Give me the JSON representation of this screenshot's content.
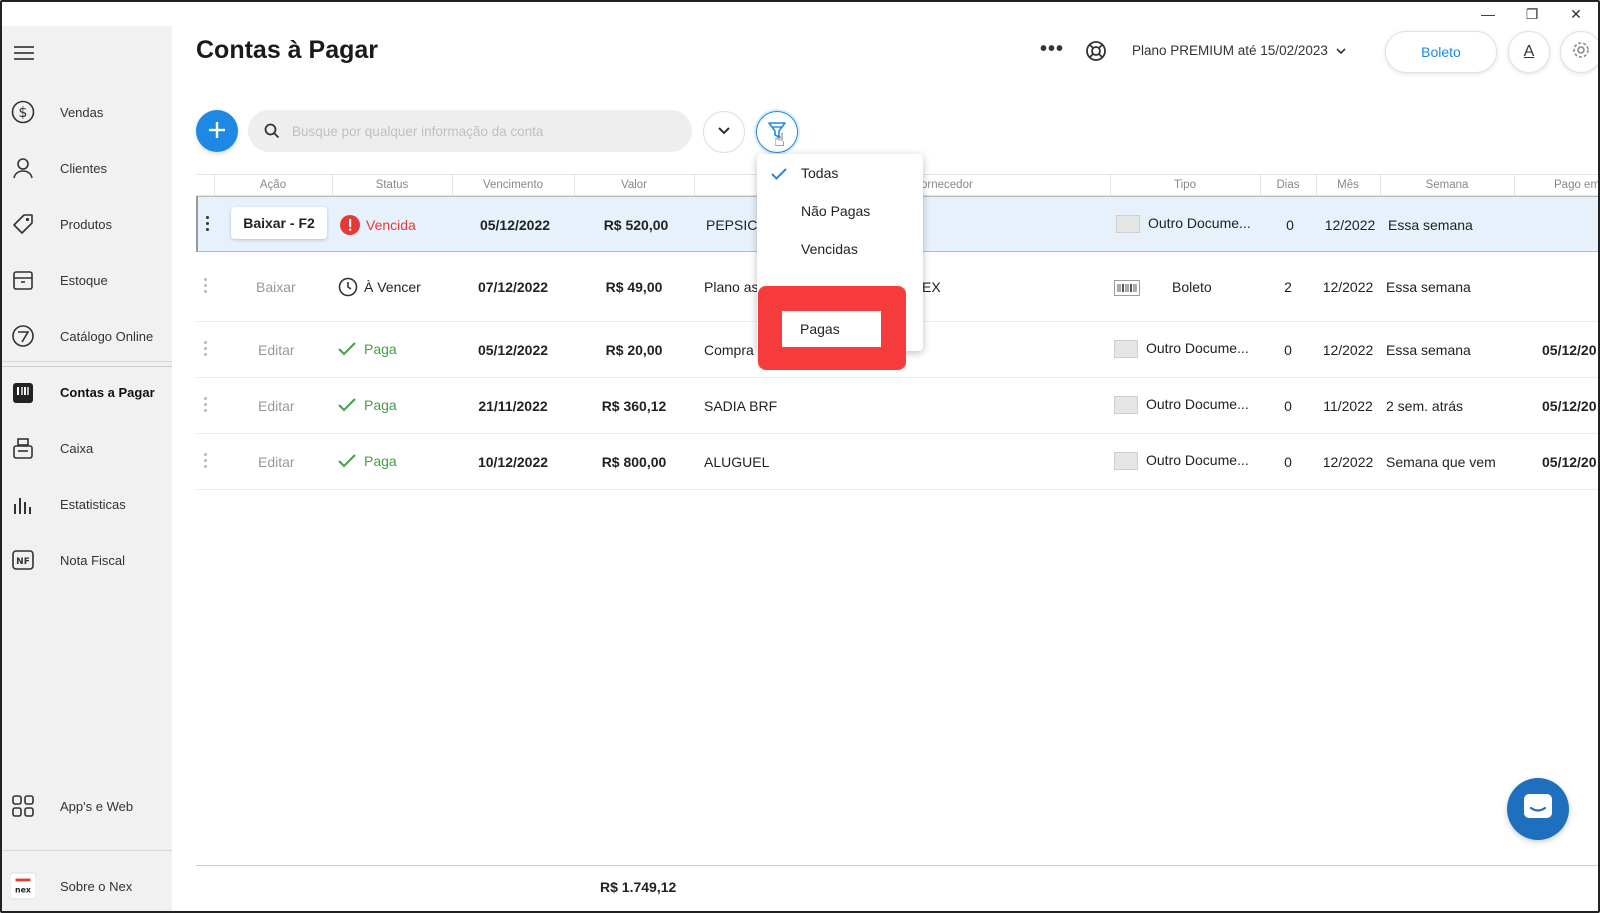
{
  "window": {
    "minimize": "—",
    "restore": "❐",
    "close": "✕"
  },
  "page": {
    "title": "Contas à Pagar"
  },
  "header": {
    "more": "•••",
    "plan": "Plano PREMIUM até 15/02/2023",
    "boleto_button": "Boleto",
    "font_button": "A"
  },
  "sidebar": {
    "items": [
      {
        "label": "Vendas",
        "icon": "dollar-icon"
      },
      {
        "label": "Clientes",
        "icon": "user-icon"
      },
      {
        "label": "Produtos",
        "icon": "tag-icon"
      },
      {
        "label": "Estoque",
        "icon": "box-icon"
      },
      {
        "label": "Catálogo Online",
        "icon": "catalog-icon"
      },
      {
        "label": "Contas a Pagar",
        "icon": "bills-icon"
      },
      {
        "label": "Caixa",
        "icon": "cash-register-icon"
      },
      {
        "label": "Estatisticas",
        "icon": "chart-icon"
      },
      {
        "label": "Nota Fiscal",
        "icon": "nf-icon"
      }
    ],
    "apps": "App's e Web",
    "about": "Sobre o Nex",
    "about_logo": "nex"
  },
  "search": {
    "placeholder": "Busque por qualquer informação da conta"
  },
  "table": {
    "headers": [
      "Ação",
      "Status",
      "Vencimento",
      "Valor",
      "Fornecedor",
      "Tipo",
      "Dias",
      "Mês",
      "Semana",
      "Pago em"
    ],
    "rows": [
      {
        "action": "Baixar - F2",
        "status": "Vencida",
        "due": "05/12/2022",
        "value": "R$ 520,00",
        "supplier": "PEPSICO",
        "type": "Outro Docume...",
        "days": "0",
        "month": "12/2022",
        "week": "Essa semana",
        "paid": ""
      },
      {
        "action": "Baixar",
        "status": "À Vencer",
        "due": "07/12/2022",
        "value": "R$ 49,00",
        "supplier": "Plano as",
        "supplier_tail": "EX",
        "type": "Boleto",
        "days": "2",
        "month": "12/2022",
        "week": "Essa semana",
        "paid": ""
      },
      {
        "action": "Editar",
        "status": "Paga",
        "due": "05/12/2022",
        "value": "R$ 20,00",
        "supplier": "Compra",
        "type": "Outro Docume...",
        "days": "0",
        "month": "12/2022",
        "week": "Essa semana",
        "paid": "05/12/20"
      },
      {
        "action": "Editar",
        "status": "Paga",
        "due": "21/11/2022",
        "value": "R$ 360,12",
        "supplier": "SADIA BRF",
        "type": "Outro Docume...",
        "days": "0",
        "month": "11/2022",
        "week": "2 sem. atrás",
        "paid": "05/12/20"
      },
      {
        "action": "Editar",
        "status": "Paga",
        "due": "10/12/2022",
        "value": "R$ 800,00",
        "supplier": "ALUGUEL",
        "type": "Outro Docume...",
        "days": "0",
        "month": "12/2022",
        "week": "Semana que vem",
        "paid": "05/12/20"
      }
    ]
  },
  "filter_menu": {
    "items": [
      "Todas",
      "Não Pagas",
      "Vencidas",
      "Pagas"
    ],
    "selected": "Todas",
    "highlighted": "Pagas"
  },
  "footer": {
    "total": "R$ 1.749,12"
  },
  "colors": {
    "accent": "#1e88e5",
    "danger": "#e53935",
    "success": "#43a047",
    "highlight": "#f53b3b"
  }
}
